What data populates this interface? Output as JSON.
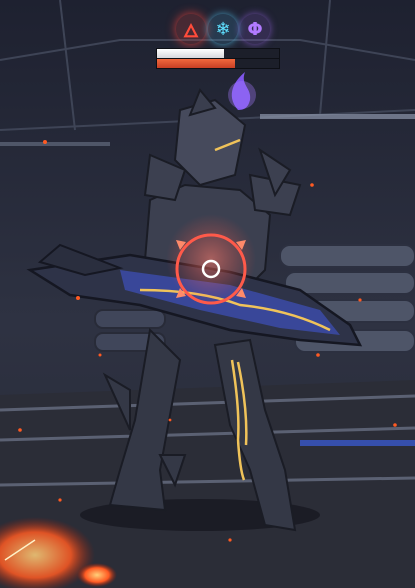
{
  "enemy": {
    "name": "armored-greatsword-knight",
    "elements": [
      {
        "name": "pyro",
        "icon": "pyro-element-icon",
        "glyph": "🜂",
        "color": "#ff4b3a"
      },
      {
        "name": "cryo",
        "icon": "cryo-element-icon",
        "glyph": "❄",
        "color": "#5fe0ff"
      },
      {
        "name": "electro",
        "icon": "electro-element-icon",
        "glyph": "Φ",
        "color": "#b27bff"
      }
    ],
    "shield_fraction": 0.55,
    "hp_fraction": 0.64
  },
  "target_lock": {
    "active": true,
    "color": "#ff5a4a"
  },
  "colors": {
    "armor": "#3c4050",
    "blade_blue": "#3b4ba8",
    "glow_gold": "#f0c35a",
    "ember": "#ff5a22",
    "floor": "#2b2d37"
  }
}
